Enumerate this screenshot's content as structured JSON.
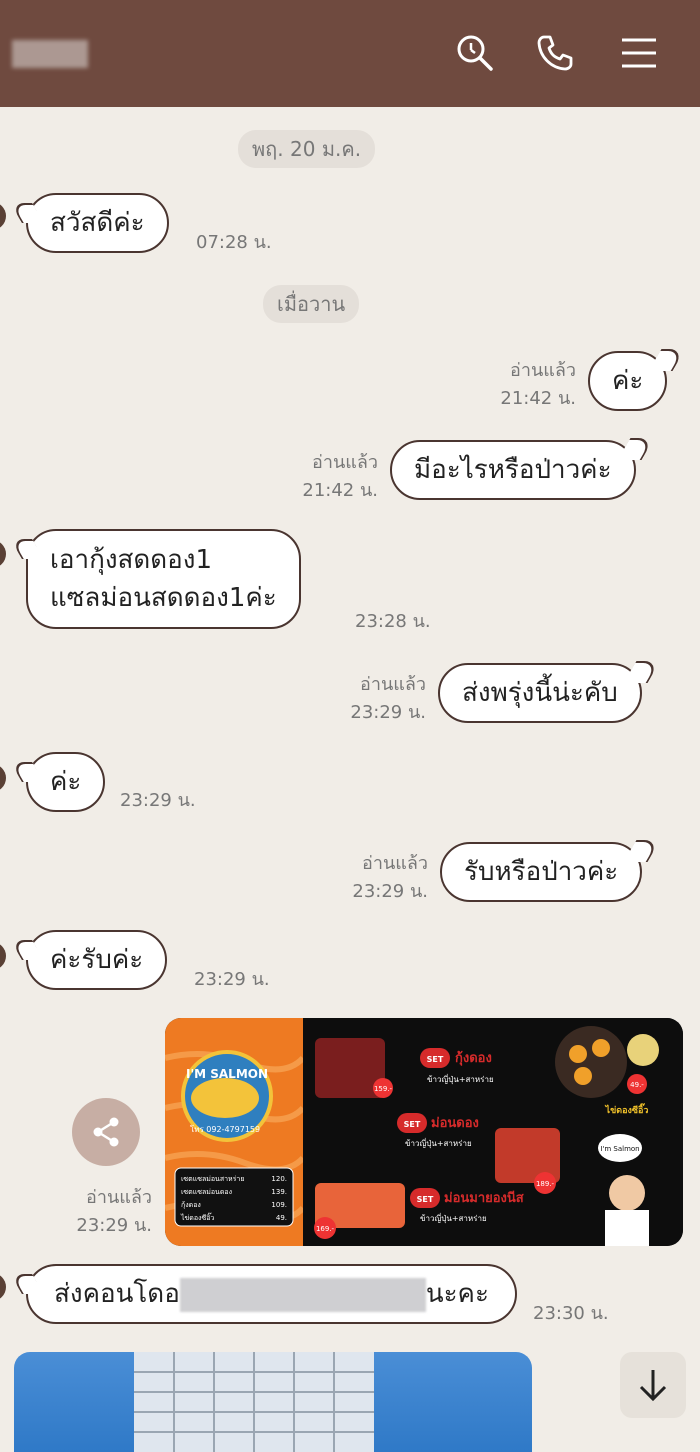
{
  "header": {
    "icons": [
      "search-icon",
      "phone-icon",
      "menu-icon"
    ],
    "color": "#6f4a3f"
  },
  "dates": {
    "d1": "พฤ. 20 ม.ค.",
    "d2": "เมื่อวาน"
  },
  "messages": [
    {
      "side": "left",
      "text": "สวัสดีค่ะ",
      "time": "07:28 น."
    },
    {
      "side": "right",
      "read": "อ่านแล้ว",
      "text": "ค่ะ",
      "time": "21:42 น."
    },
    {
      "side": "right",
      "read": "อ่านแล้ว",
      "text": "มีอะไรหรือป่าวค่ะ",
      "time": "21:42 น."
    },
    {
      "side": "left",
      "line1": "เอากุ้งสดดอง1",
      "line2": "แซลม่อนสดดอง1ค่ะ",
      "time": "23:28 น."
    },
    {
      "side": "right",
      "read": "อ่านแล้ว",
      "text": "ส่งพรุ่งนี้น่ะคับ",
      "time": "23:29 น."
    },
    {
      "side": "left",
      "text": "ค่ะ",
      "time": "23:29 น."
    },
    {
      "side": "right",
      "read": "อ่านแล้ว",
      "text": "รับหรือป่าวค่ะ",
      "time": "23:29 น."
    },
    {
      "side": "left",
      "text": "ค่ะรับค่ะ",
      "time": "23:29 น."
    },
    {
      "side": "right",
      "read": "อ่านแล้ว",
      "time": "23:29 น."
    },
    {
      "side": "left",
      "text_start": "ส่งคอนโดอ",
      "text_end": "นะคะ",
      "time": "23:30 น."
    }
  ],
  "menu_image": {
    "logo_text": "I'M SALMON",
    "phone": "โทร 092-4797159",
    "prices": [
      {
        "item": "เซตแซลม่อนสาหร่าย",
        "price": "120."
      },
      {
        "item": "เซตแซลม่อนดอง",
        "price": "139."
      },
      {
        "item": "กุ้งดอง",
        "price": "109."
      },
      {
        "item": "ไข่ดองซีอิ๊ว",
        "price": "49."
      }
    ],
    "sets": [
      {
        "badge": "SET",
        "title": "กุ้งดอง",
        "sub": "ข้าวญี่ปุ่น+สาหร่าย",
        "price": "159.-"
      },
      {
        "badge": "SET",
        "title": "ม่อนดอง",
        "sub": "ข้าวญี่ปุ่น+สาหร่าย",
        "price": "189.-"
      },
      {
        "badge": "SET",
        "title": "ม่อนมายองนีส",
        "sub": "ข้าวญี่ปุ่น+สาหร่าย",
        "price": "169.-"
      }
    ],
    "egg_label": "ไข่ดองซีอิ๊ว",
    "egg_price": "49.-",
    "bubble_text": "I'm Salmon"
  }
}
